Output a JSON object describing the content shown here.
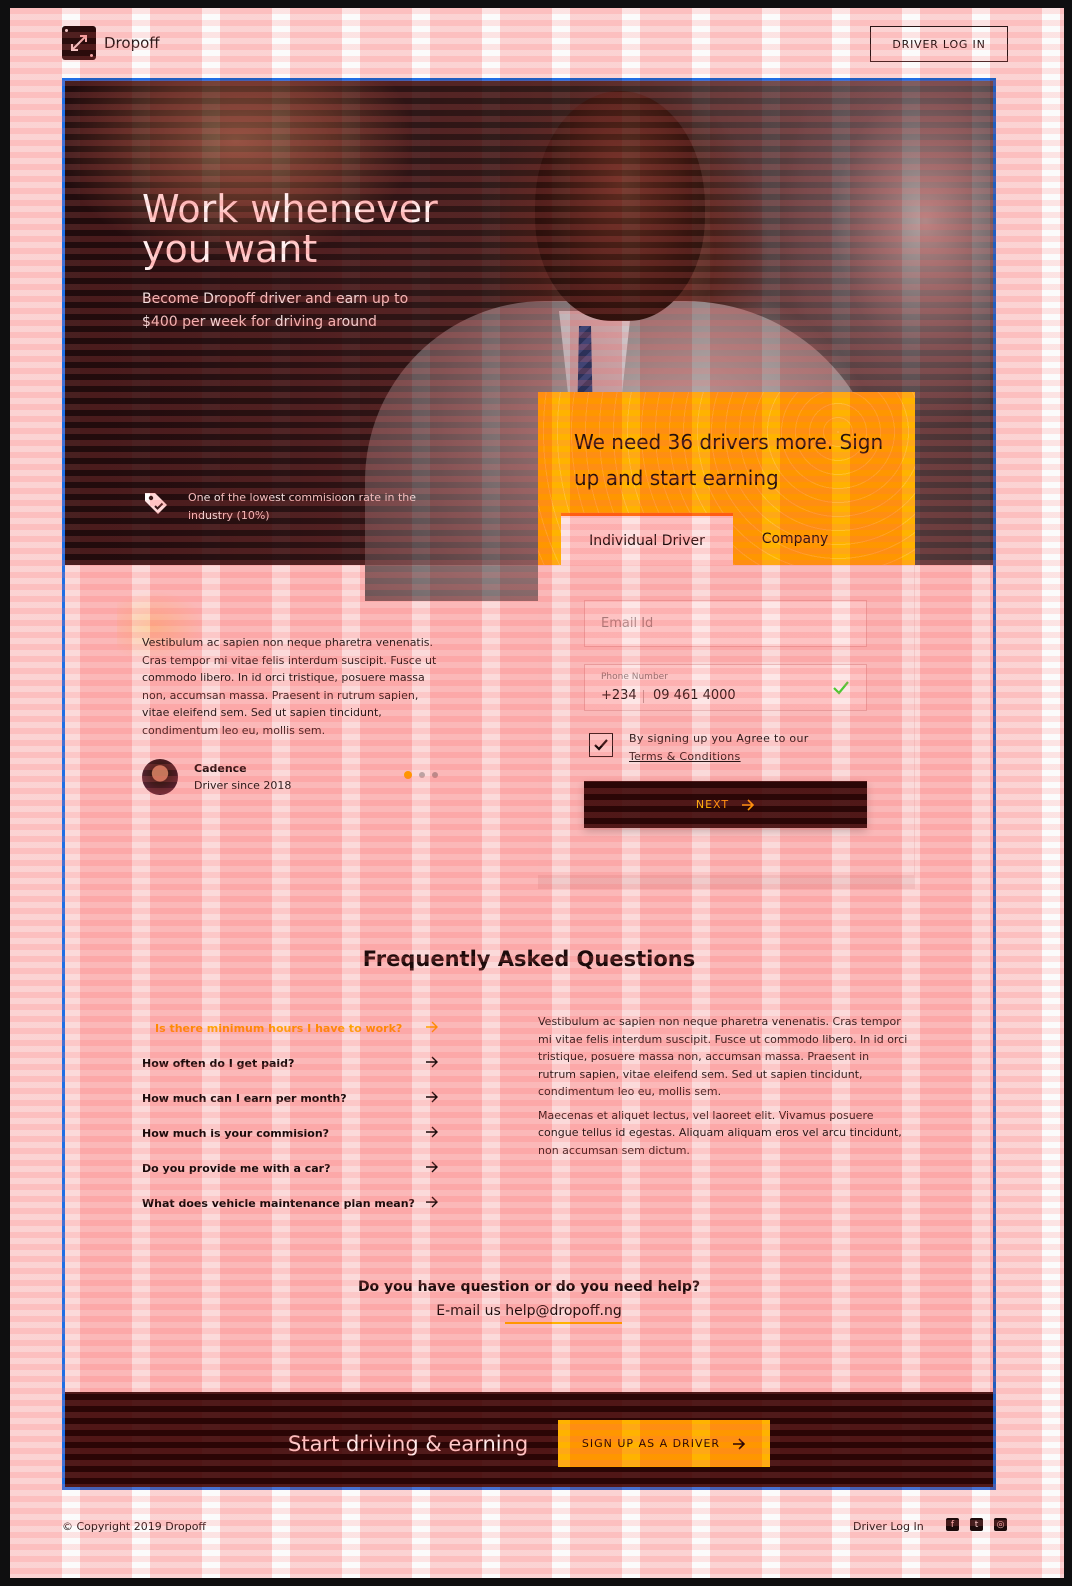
{
  "brand": {
    "name": "Dropoff"
  },
  "header": {
    "login_label": "DRIVER LOG IN"
  },
  "hero": {
    "title": "Work whenever you want",
    "subtitle": "Become Dropoff driver and earn up to $400 per week for driving around",
    "feature_text": "One of the lowest commisioon rate in the industry (10%)",
    "feature_icon": "tag-icon"
  },
  "signup": {
    "title": "We need 36 drivers more. Sign up and start earning",
    "tabs": [
      {
        "label": "Individual Driver",
        "active": true
      },
      {
        "label": "Company",
        "active": false
      }
    ],
    "email_placeholder": "Email Id",
    "phone": {
      "label": "Phone Number",
      "code": "+234",
      "number": "09 461 4000"
    },
    "terms_prefix": "By signing up you Agree to our",
    "terms_link": "Terms & Conditions",
    "terms_checked": true,
    "next_label": "NEXT"
  },
  "testimonial": {
    "text": "Vestibulum ac sapien non neque pharetra venenatis. Cras tempor mi vitae felis interdum suscipit. Fusce ut commodo libero. In id orci tristique, posuere massa non, accumsan massa. Praesent in rutrum sapien, vitae eleifend sem. Sed ut sapien tincidunt, condimentum leo eu, mollis sem.",
    "name": "Cadence",
    "role": "Driver since 2018",
    "slides": 3,
    "active_slide": 1
  },
  "faq": {
    "title": "Frequently Asked Questions",
    "questions": [
      "Is  there minimum hours I have to work?",
      "How often do I get paid?",
      "How much can I earn per month?",
      "How much is your commision?",
      "Do you provide me with a car?",
      "What does vehicle maintenance plan mean?"
    ],
    "active_index": 0,
    "answer": [
      "Vestibulum ac sapien non neque pharetra venenatis. Cras tempor mi vitae felis interdum suscipit. Fusce ut commodo libero. In id orci tristique, posuere massa non, accumsan massa. Praesent in rutrum sapien, vitae eleifend sem. Sed ut sapien tincidunt, condimentum leo eu, mollis sem.",
      "Maecenas et aliquet lectus, vel laoreet elit. Vivamus posuere congue tellus id egestas. Aliquam aliquam eros vel arcu tincidunt, non accumsan sem dictum."
    ]
  },
  "help": {
    "question": "Do you have question or do you need help?",
    "email_prefix": "E-mail us ",
    "email": "help@dropoff.ng"
  },
  "cta": {
    "text": "Start driving & earning",
    "button_label": "SIGN UP AS A DRIVER"
  },
  "footer": {
    "copyright": "© Copyright 2019 Dropoff",
    "login_link": "Driver Log In",
    "social": [
      "facebook-icon",
      "twitter-icon",
      "instagram-icon"
    ]
  },
  "colors": {
    "accent": "#ffb300",
    "dark": "#2a0505",
    "highlight_border": "#1f6fe5",
    "tab_indicator": "#ff6a00"
  }
}
